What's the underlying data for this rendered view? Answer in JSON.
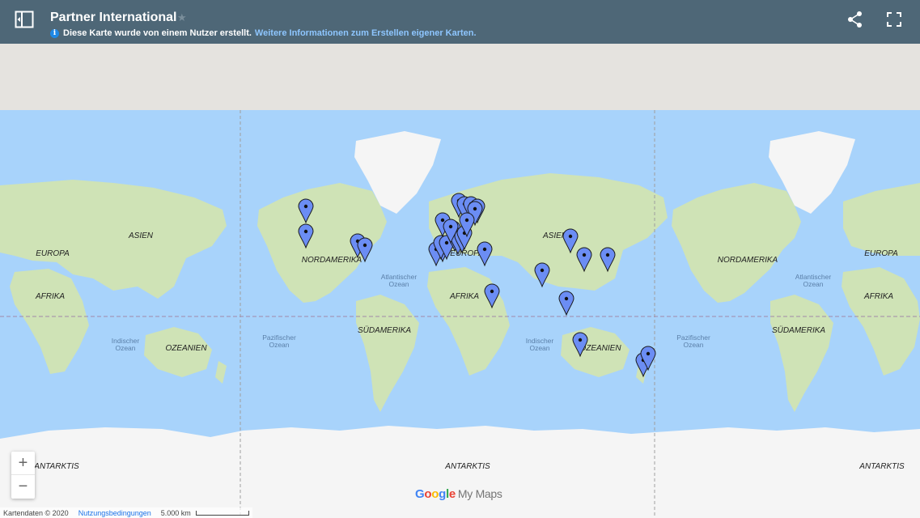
{
  "header": {
    "title": "Partner International",
    "info_text": "Diese Karte wurde von einem Nutzer erstellt.",
    "info_link": "Weitere Informationen zum Erstellen eigener Karten.",
    "info_glyph": "i"
  },
  "zoom": {
    "in_label": "+",
    "out_label": "−"
  },
  "map": {
    "labels": {
      "europa": "EUROPA",
      "asien": "ASIEN",
      "afrika": "AFRIKA",
      "nordamerika": "NORDAMERIKA",
      "suedamerika": "SÜDAMERIKA",
      "ozeanien": "OZEANIEN",
      "antarktis": "ANTARKTIS",
      "atlantischer": "Atlantischer",
      "pazifischer": "Pazifischer",
      "indischer": "Indischer",
      "ozean": "Ozean"
    },
    "colors": {
      "ocean": "#a8d3fb",
      "land": "#cfe3b6",
      "ice": "#f5f5f5",
      "pin": "#6b8df4"
    }
  },
  "attribution": {
    "mapdata": "Kartendaten © 2020",
    "terms": "Nutzungsbedingungen",
    "scale": "5.000 km"
  },
  "branding": {
    "google": "Google",
    "mymaps": "My Maps"
  }
}
